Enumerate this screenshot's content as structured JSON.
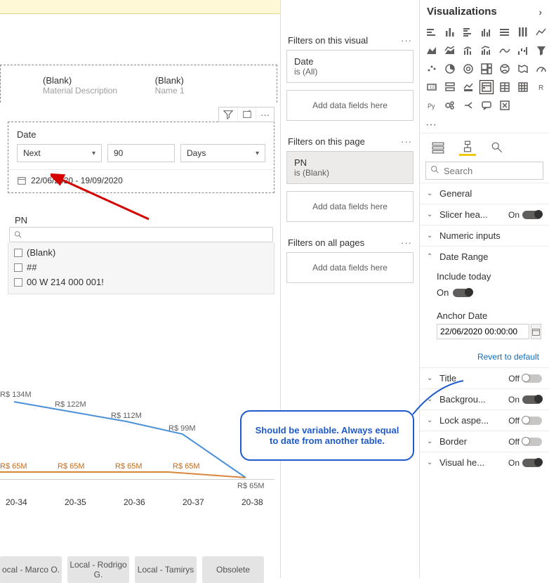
{
  "yellowbar": {
    "close": "×"
  },
  "tableHeader": {
    "cols": [
      {
        "name": "(Blank)",
        "sub": "Material Description"
      },
      {
        "name": "(Blank)",
        "sub": "Name 1"
      }
    ]
  },
  "slicer": {
    "title": "Date",
    "relative": "Next",
    "count": "90",
    "unit": "Days",
    "range": "22/06/2020 - 19/09/2020"
  },
  "pn": {
    "title": "PN",
    "items": [
      "(Blank)",
      "##",
      "00 W 214 000 001!"
    ]
  },
  "chart_data": {
    "type": "line",
    "categories": [
      "20-34",
      "20-35",
      "20-36",
      "20-37",
      "20-38"
    ],
    "series": [
      {
        "name": "blue",
        "values": [
          134,
          122,
          112,
          99,
          65
        ]
      },
      {
        "name": "orange",
        "values": [
          65,
          65,
          65,
          65,
          65
        ]
      }
    ],
    "labels_blue": [
      "R$ 134M",
      "R$ 122M",
      "R$ 112M",
      "R$ 99M",
      "R$ 65M"
    ],
    "labels_orange": [
      "R$ 65M",
      "R$ 65M",
      "R$ 65M",
      "R$ 65M",
      "R$ 65M"
    ],
    "currency": "R$",
    "unit": "M"
  },
  "buttons": [
    "ocal - Marco O.",
    "Local - Rodrigo G.",
    "Local - Tamirys",
    "Obsolete"
  ],
  "filters": {
    "visual": {
      "title": "Filters on this visual",
      "card": {
        "name": "Date",
        "val": "is (All)"
      },
      "drop": "Add data fields here"
    },
    "page": {
      "title": "Filters on this page",
      "card": {
        "name": "PN",
        "val": "is (Blank)"
      },
      "drop": "Add data fields here"
    },
    "all": {
      "title": "Filters on all pages",
      "drop": "Add data fields here"
    }
  },
  "viz": {
    "title": "Visualizations",
    "searchPlaceholder": "Search",
    "rows": {
      "general": "General",
      "slicerHeader": "Slicer hea...",
      "numeric": "Numeric inputs",
      "dateRange": "Date Range",
      "includeToday": "Include today",
      "anchorDate": "Anchor Date",
      "anchorValue": "22/06/2020 00:00:00",
      "revert": "Revert to default",
      "title_row": "Title",
      "background": "Backgrou...",
      "lockAspect": "Lock aspe...",
      "border": "Border",
      "visualHeader": "Visual he..."
    },
    "toggles": {
      "slicerHeader": "On",
      "includeToday": "On",
      "title_row": "Off",
      "background": "On",
      "lockAspect": "Off",
      "border": "Off",
      "visualHeader": "On"
    }
  },
  "callout": "Should be variable. Always equal to date from another table."
}
